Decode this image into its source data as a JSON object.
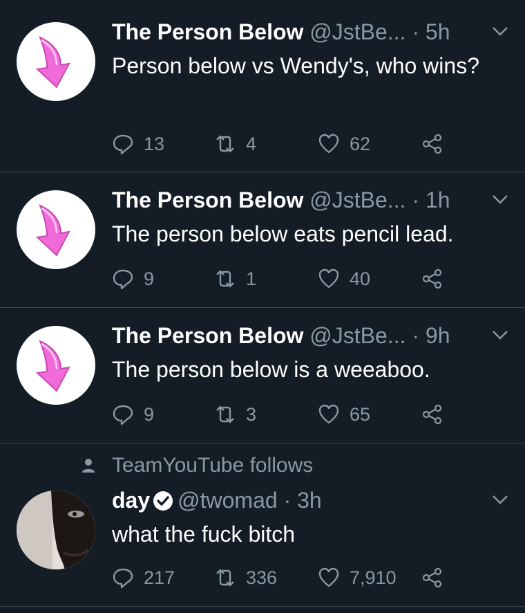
{
  "tweets": [
    {
      "name": "The Person Below",
      "handle": "@JstBe...",
      "time": "5h",
      "text": "Person below vs Wendy's, who wins?",
      "replies": "13",
      "retweets": "4",
      "likes": "62",
      "avatar_icon": "pink-down-arrow-icon"
    },
    {
      "name": "The Person Below",
      "handle": "@JstBe...",
      "time": "1h",
      "text": "The person below eats pencil lead.",
      "replies": "9",
      "retweets": "1",
      "likes": "40",
      "avatar_icon": "pink-down-arrow-icon"
    },
    {
      "name": "The Person Below",
      "handle": "@JstBe...",
      "time": "9h",
      "text": "The person below is a weeaboo.",
      "replies": "9",
      "retweets": "3",
      "likes": "65",
      "avatar_icon": "pink-down-arrow-icon"
    },
    {
      "context": "TeamYouTube follows",
      "name": "day",
      "handle": "@twomad",
      "time": "3h",
      "text": "what the fuck bitch",
      "replies": "217",
      "retweets": "336",
      "likes": "7,910",
      "verified": true
    }
  ],
  "separator": "·",
  "colors": {
    "background": "#141d26",
    "muted": "#8899a6",
    "divider": "#38444d",
    "arrow_pink": "#f06ad8"
  }
}
